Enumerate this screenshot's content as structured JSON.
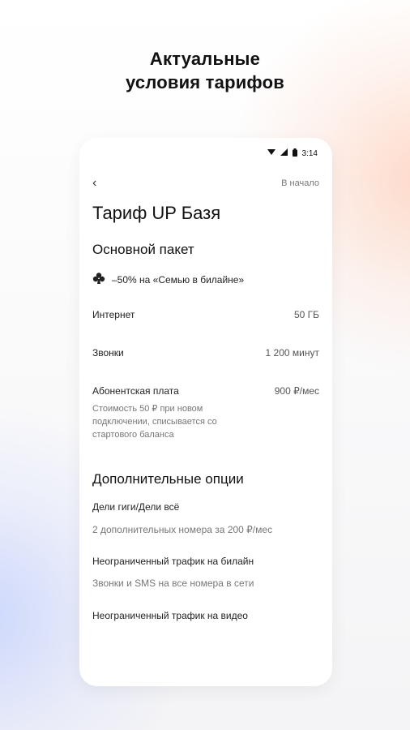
{
  "headline": {
    "line1": "Актуальные",
    "line2": "условия тарифов"
  },
  "status_bar": {
    "time": "3:14",
    "icons": [
      "wifi-icon",
      "signal-icon",
      "battery-icon"
    ]
  },
  "nav": {
    "back_glyph": "‹",
    "home_link": "В начало"
  },
  "tariff": {
    "title": "Тариф UP Базя",
    "main_section_title": "Основной пакет",
    "promo_text": "–50% на «Семью в билайне»",
    "rows": [
      {
        "label": "Интернет",
        "value": "50 ГБ"
      },
      {
        "label": "Звонки",
        "value": "1 200 минут"
      },
      {
        "label": "Абонентская плата",
        "value": "900 ₽/мес"
      }
    ],
    "fee_note": "Стоимость 50 ₽ при новом подключении, списывается со стартового баланса"
  },
  "options": {
    "section_title": "Дополнительные опции",
    "items": [
      {
        "title": "Дели гиги/Дели всё",
        "subtitle": "2 дополнительных номера за 200 ₽/мес"
      },
      {
        "title": "Неограниченный трафик на билайн",
        "subtitle": "Звонки и SMS на все номера в сети"
      },
      {
        "title": "Неограниченный трафик на видео",
        "subtitle": ""
      }
    ]
  },
  "colors": {
    "text": "#111111",
    "muted": "#777777"
  }
}
